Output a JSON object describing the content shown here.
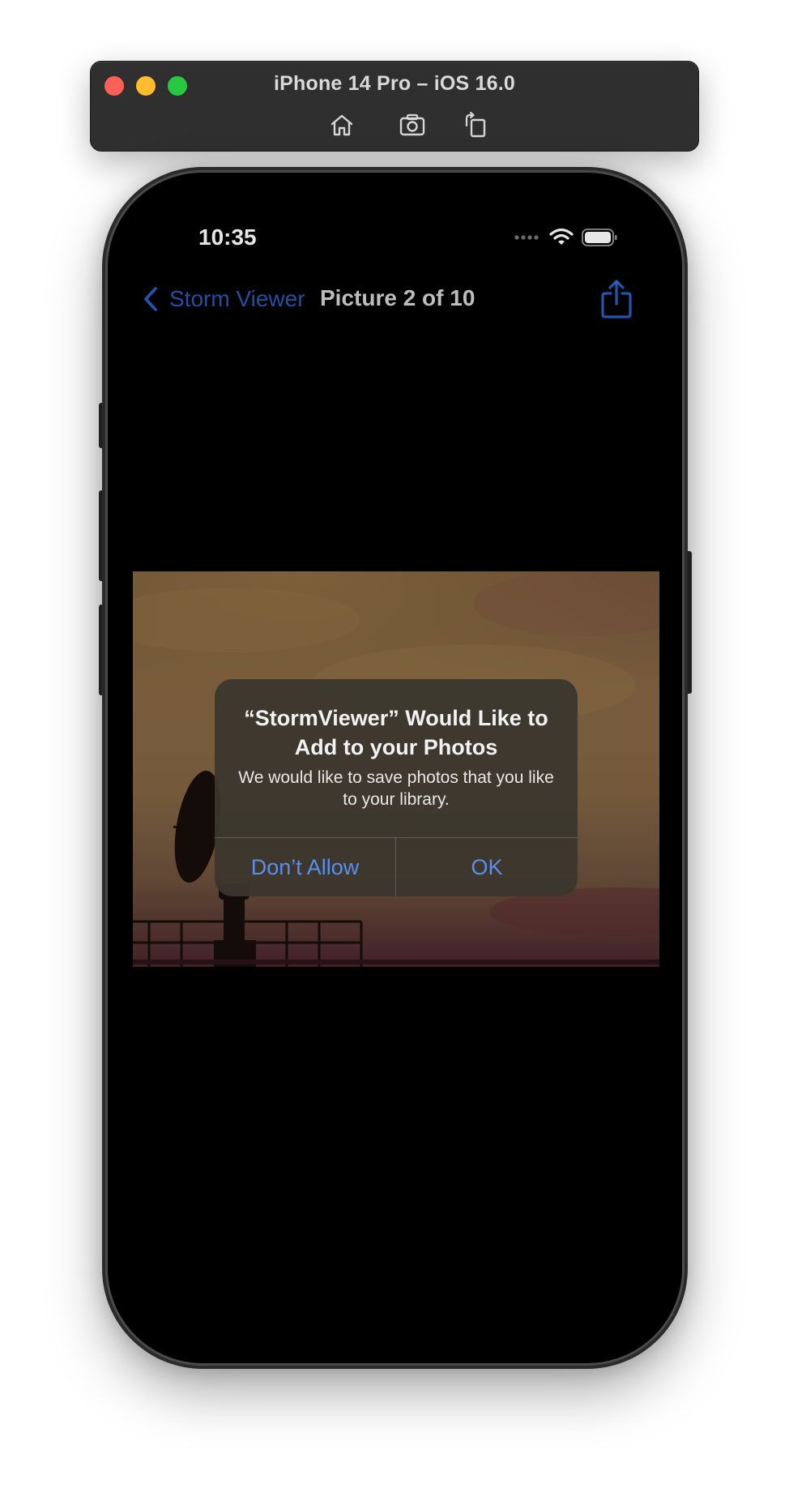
{
  "simulator": {
    "title": "iPhone 14 Pro – iOS 16.0",
    "tools": [
      {
        "icon": "home-icon"
      },
      {
        "icon": "screenshot-icon"
      },
      {
        "icon": "rotate-icon"
      }
    ]
  },
  "status_bar": {
    "time": "10:35",
    "icons": [
      "signal-dots-icon",
      "wifi-icon",
      "battery-icon"
    ]
  },
  "nav": {
    "back_label": "Storm Viewer",
    "title": "Picture 2 of 10",
    "share_icon": "share-icon"
  },
  "alert": {
    "title": "“StormViewer” Would Like to Add to your Photos",
    "message": "We would like to save photos that you like to your library.",
    "deny_label": "Don’t Allow",
    "ok_label": "OK"
  },
  "colors": {
    "ios_blue": "#2d6ad8",
    "alert_button": "#5a8fea",
    "traffic_red": "#fe5f57",
    "traffic_yellow": "#febc2e",
    "traffic_green": "#28c840"
  }
}
